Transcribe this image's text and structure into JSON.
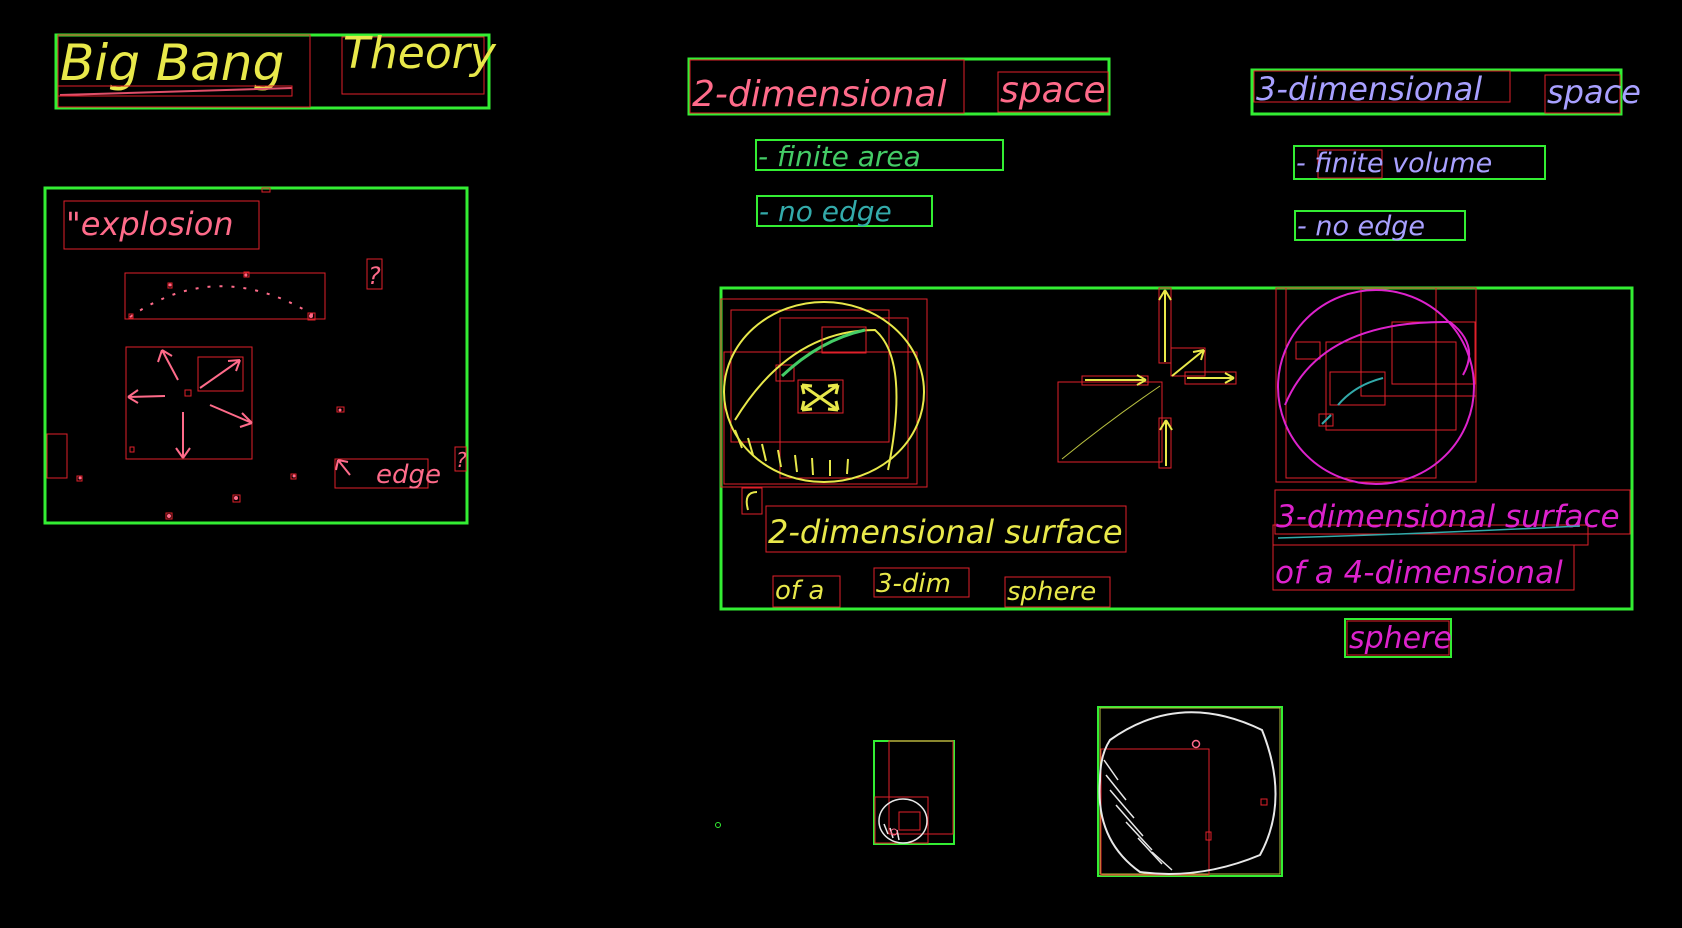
{
  "colors": {
    "background": "#000000",
    "group_box": "#33ee33",
    "item_box": "#e0202a",
    "title": "#e8e84a",
    "explosion": "#ff6b8a",
    "two_d": "#e8e84a",
    "two_d_green": "#44cc66",
    "two_d_teal": "#33aaaa",
    "three_d": "#a8a0ff",
    "four_d": "#dd22cc",
    "white_chalk": "#e8e8e8"
  },
  "title": {
    "part1": "Big Bang",
    "part2": "Theory"
  },
  "left_panel": {
    "explosion": "\"explosion",
    "question1": "?",
    "edge": "edge",
    "question2": "?"
  },
  "two_d": {
    "heading_left": "2-dimensional",
    "heading_right": "space",
    "finite": "- finite area",
    "no_edge": "- no edge"
  },
  "three_d": {
    "heading_left": "3-dimensional",
    "heading_right": "space",
    "finite": "- finite volume",
    "no_edge": "- no edge"
  },
  "middle_panel": {
    "surface_line1": "2-dimensional surface",
    "of_a": "of a",
    "three_dim": "3-dim",
    "sphere": "sphere",
    "right_line1": "3-dimensional surface",
    "right_line2": "of a 4-dimensional",
    "right_line3": "sphere"
  }
}
